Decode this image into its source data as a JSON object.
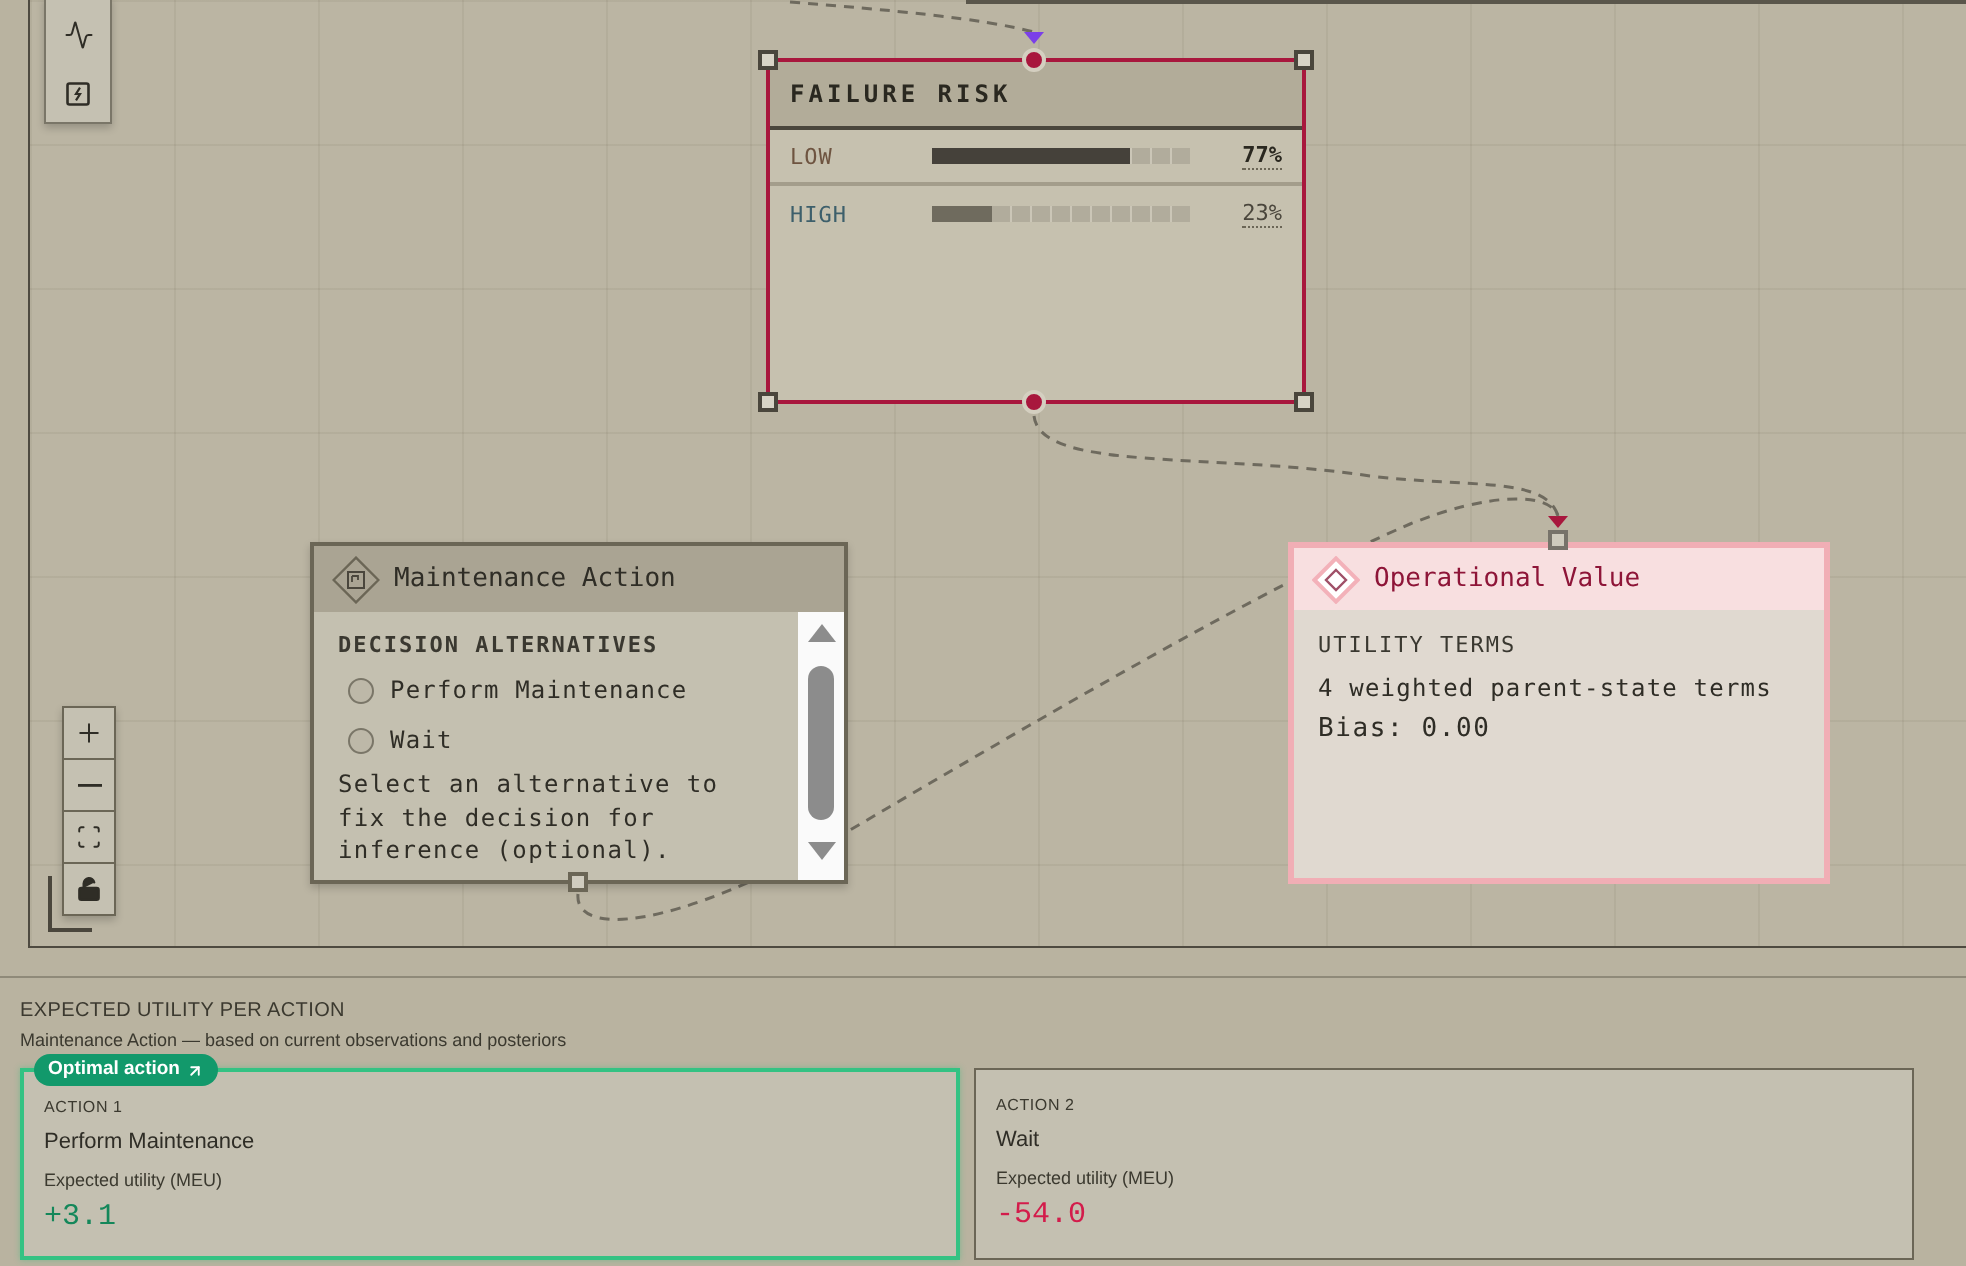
{
  "failure_risk_node": {
    "title": "FAILURE RISK",
    "selected": true,
    "states": [
      {
        "label": "LOW",
        "color": "#6e5440",
        "level": 0.77,
        "reading": "77%"
      },
      {
        "label": "HIGH",
        "color": "#3d5f6b",
        "level": 0.23,
        "reading": "23%"
      }
    ]
  },
  "decision_node": {
    "title": "Maintenance Action",
    "section": "DECISION ALTERNATIVES",
    "alternatives": [
      {
        "label": "Perform Maintenance",
        "selected": false
      },
      {
        "label": "Wait",
        "selected": false
      }
    ],
    "hint": "Select an alternative to fix the decision for inference (optional)."
  },
  "utility_node": {
    "title": "Operational Value",
    "section": "UTILITY TERMS",
    "terms": "4 weighted parent-state terms",
    "bias": "Bias: 0.00"
  },
  "expected_utility": {
    "title": "EXPECTED UTILITY PER ACTION",
    "subtitle": "Maintenance Action — based on current observations and posteriors",
    "actions": [
      {
        "index": "ACTION 1",
        "name": "Perform Maintenance",
        "badge": "Optimal action",
        "optimal": true,
        "utility_label": "Expected utility (MEU)",
        "utility": "+3.1"
      },
      {
        "index": "ACTION 2",
        "name": "Wait",
        "optimal": false,
        "utility_label": "Expected utility (MEU)",
        "utility": "-54.0"
      }
    ]
  }
}
